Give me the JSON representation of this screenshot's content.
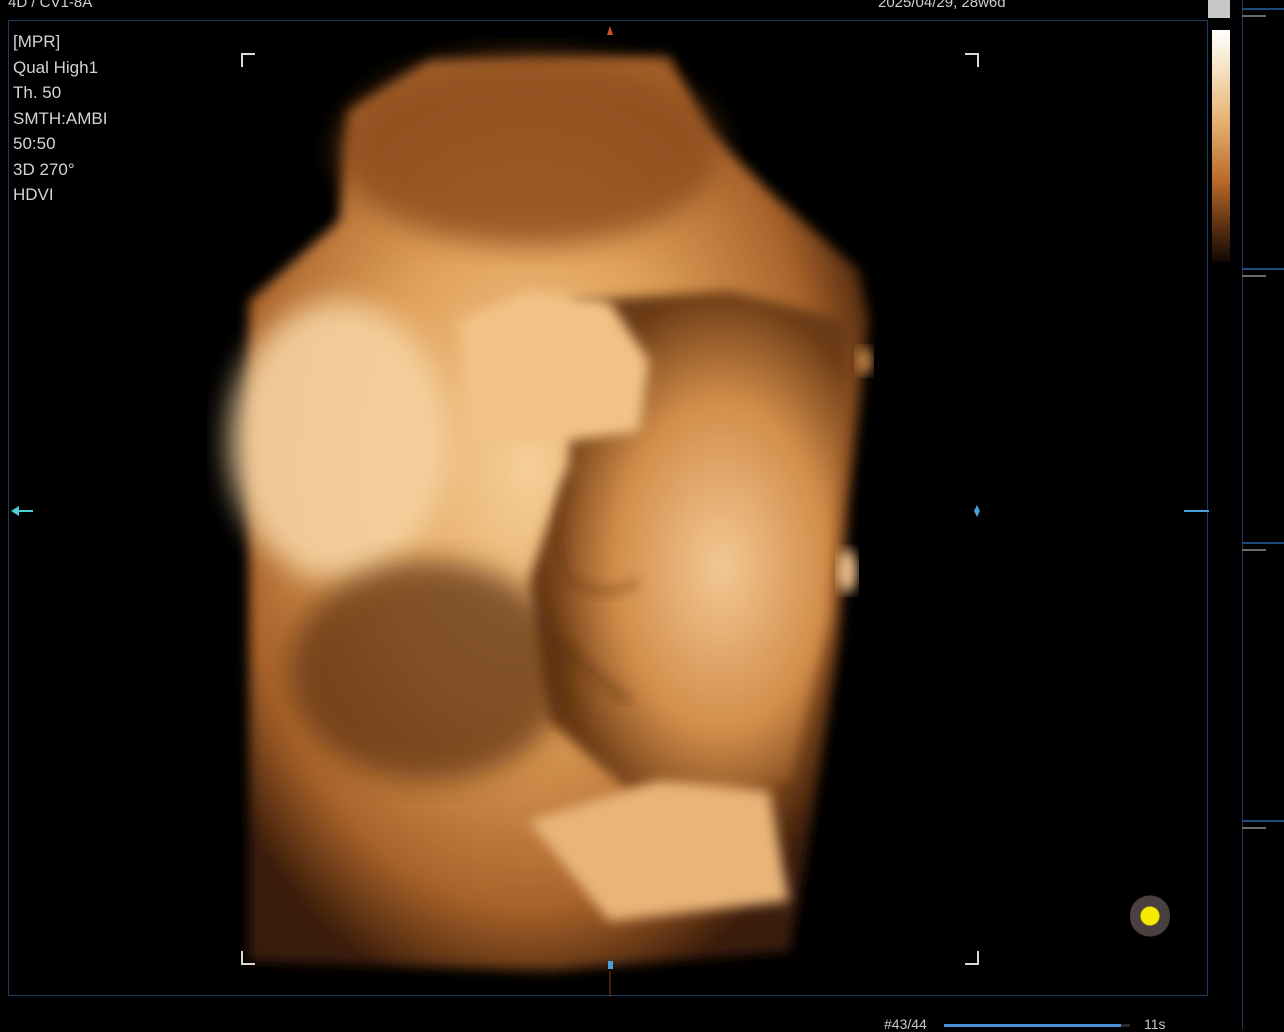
{
  "header": {
    "probe": "4D / CV1-8A",
    "date": "2025/04/29, 28w6d"
  },
  "params": [
    "[MPR]",
    "Qual High1",
    "Th. 50",
    "SMTH:AMBI",
    "50:50",
    "3D 270°",
    "HDVI"
  ],
  "footer": {
    "frame": "#43/44",
    "time": "11s",
    "progress": 0.95
  },
  "colors": {
    "accent": "#4a90d9",
    "frame_border": "#1d3b5e",
    "render_tone": "#e0a05a"
  }
}
